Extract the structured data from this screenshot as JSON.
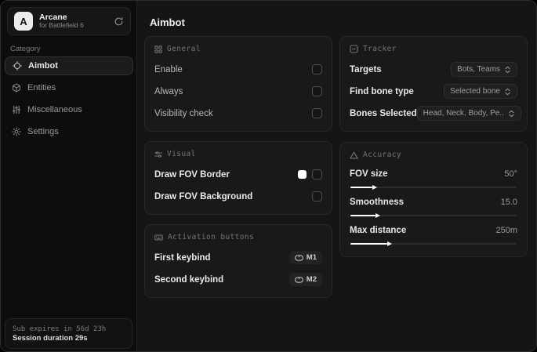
{
  "app": {
    "name": "Arcane",
    "subtitle": "for Battlefield 6",
    "logo_letter": "A"
  },
  "colors": {
    "background": "#151515",
    "sidebar": "#0d0d0d",
    "card": "#191919",
    "accent": "#ffffff",
    "muted_text": "#767676"
  },
  "sidebar": {
    "category_label": "Category",
    "items": [
      {
        "label": "Aimbot",
        "icon": "crosshair-icon",
        "active": true
      },
      {
        "label": "Entities",
        "icon": "cube-icon",
        "active": false
      },
      {
        "label": "Miscellaneous",
        "icon": "sliders-icon",
        "active": false
      },
      {
        "label": "Settings",
        "icon": "gear-icon",
        "active": false
      }
    ],
    "footer": {
      "sub_expires": "Sub expires in 56d 23h",
      "session_duration": "Session duration 29s"
    }
  },
  "main": {
    "title": "Aimbot",
    "sections": {
      "general": {
        "title": "General",
        "rows": [
          {
            "label": "Enable",
            "checked": false
          },
          {
            "label": "Always",
            "checked": false
          },
          {
            "label": "Visibility check",
            "checked": false
          }
        ]
      },
      "visual": {
        "title": "Visual",
        "rows": [
          {
            "label": "Draw FOV Border",
            "swatch_color": "#ffffff",
            "checked": false
          },
          {
            "label": "Draw FOV Background",
            "checked": false
          }
        ]
      },
      "activation": {
        "title": "Activation buttons",
        "rows": [
          {
            "label": "First keybind",
            "key": "M1"
          },
          {
            "label": "Second keybind",
            "key": "M2"
          }
        ]
      },
      "tracker": {
        "title": "Tracker",
        "rows": [
          {
            "label": "Targets",
            "value": "Bots, Teams"
          },
          {
            "label": "Find bone type",
            "value": "Selected bone"
          },
          {
            "label": "Bones Selected",
            "value": "Head, Neck, Body, Pe.."
          }
        ]
      },
      "accuracy": {
        "title": "Accuracy",
        "rows": [
          {
            "label": "FOV size",
            "value": "50°",
            "fill_pct": 13
          },
          {
            "label": "Smoothness",
            "value": "15.0",
            "fill_pct": 15
          },
          {
            "label": "Max distance",
            "value": "250m",
            "fill_pct": 22
          }
        ]
      }
    }
  }
}
